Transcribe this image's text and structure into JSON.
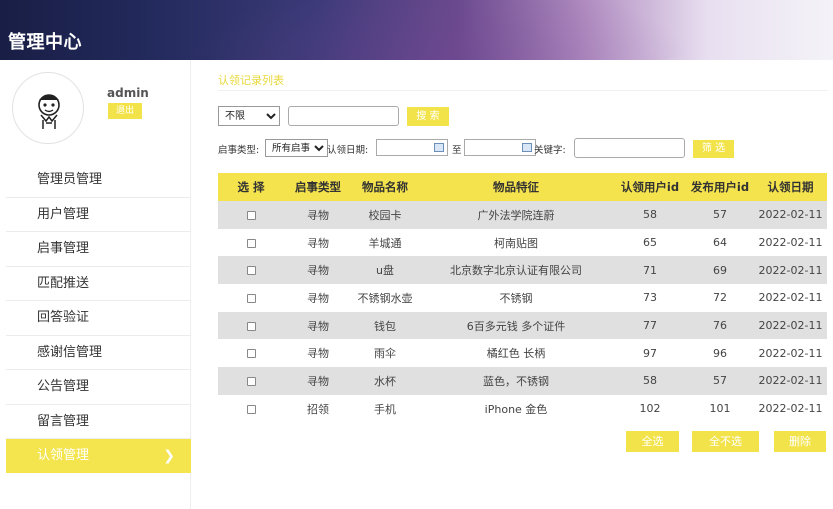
{
  "header": {
    "title": "管理中心"
  },
  "profile": {
    "username": "admin",
    "logout_label": "退出"
  },
  "sidebar": {
    "items": [
      {
        "label": "管理员管理"
      },
      {
        "label": "用户管理"
      },
      {
        "label": "启事管理"
      },
      {
        "label": "匹配推送"
      },
      {
        "label": "回答验证"
      },
      {
        "label": "感谢信管理"
      },
      {
        "label": "公告管理"
      },
      {
        "label": "留言管理"
      },
      {
        "label": "认领管理",
        "active": true,
        "arrow": "❯"
      }
    ]
  },
  "main": {
    "section_title": "认领记录列表",
    "search": {
      "scope_selected": "不限",
      "keyword_value": "",
      "search_label": "搜 索"
    },
    "filter": {
      "type_label": "启事类型:",
      "type_selected": "所有启事",
      "date_label": "认领日期:",
      "to_label": "至",
      "keyword_label": "关键字:",
      "keyword_value": "",
      "filter_label": "筛 选"
    },
    "table": {
      "headers": [
        "选 择",
        "启事类型",
        "物品名称",
        "物品特征",
        "认领用户id",
        "发布用户id",
        "认领日期"
      ],
      "rows": [
        [
          "寻物",
          "校园卡",
          "广外法学院连蔚",
          "58",
          "57",
          "2022-02-11"
        ],
        [
          "寻物",
          "羊城通",
          "柯南贴图",
          "65",
          "64",
          "2022-02-11"
        ],
        [
          "寻物",
          "u盘",
          "北京数字北京认证有限公司",
          "71",
          "69",
          "2022-02-11"
        ],
        [
          "寻物",
          "不锈钢水壶",
          "不锈钢",
          "73",
          "72",
          "2022-02-11"
        ],
        [
          "寻物",
          "钱包",
          "6百多元钱 多个证件",
          "77",
          "76",
          "2022-02-11"
        ],
        [
          "寻物",
          "雨伞",
          "橘红色 长柄",
          "97",
          "96",
          "2022-02-11"
        ],
        [
          "寻物",
          "水杯",
          "蓝色，不锈钢",
          "58",
          "57",
          "2022-02-11"
        ],
        [
          "招领",
          "手机",
          "iPhone 金色",
          "102",
          "101",
          "2022-02-11"
        ]
      ]
    },
    "actions": {
      "select_all": "全选",
      "select_none": "全不选",
      "delete": "删除"
    }
  },
  "colors": {
    "accent_yellow": "#f4e34c",
    "row_gray": "#e0e0e0",
    "header_dark": "#191e45"
  }
}
